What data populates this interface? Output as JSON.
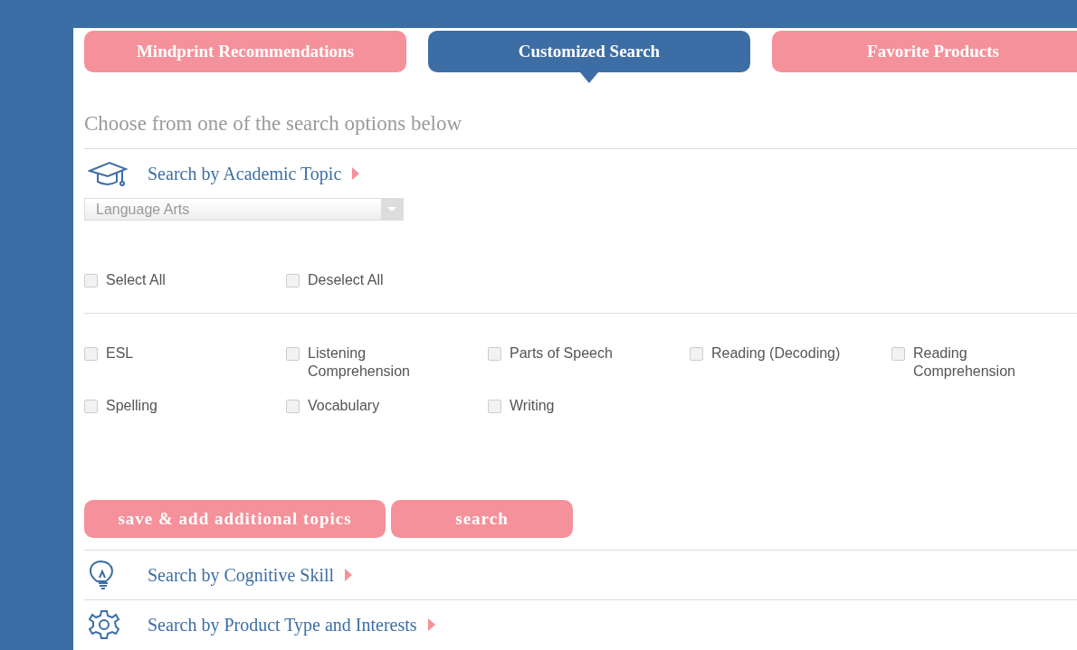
{
  "tabs": [
    {
      "label": "Mindprint Recommendations",
      "selected": false
    },
    {
      "label": "Customized Search",
      "selected": true
    },
    {
      "label": "Favorite Products",
      "selected": false
    }
  ],
  "heading": "Choose from one of the search options below",
  "academic": {
    "kind": "cap",
    "title": "Search by Academic Topic",
    "dropdown": {
      "value": "Language Arts"
    },
    "bulk": [
      {
        "label": "Select All",
        "checked": false
      },
      {
        "label": "Deselect All",
        "checked": false
      }
    ],
    "topics": [
      {
        "label": "ESL",
        "checked": false
      },
      {
        "label": "Listening Comprehension",
        "checked": false
      },
      {
        "label": "Parts of Speech",
        "checked": false
      },
      {
        "label": "Reading (Decoding)",
        "checked": false
      },
      {
        "label": "Reading Comprehension",
        "checked": false
      },
      {
        "label": "Spelling",
        "checked": false
      },
      {
        "label": "Vocabulary",
        "checked": false
      },
      {
        "label": "Writing",
        "checked": false
      }
    ],
    "buttons": [
      "save & add additional topics",
      "search"
    ]
  },
  "other_sections": [
    {
      "kind": "bulb",
      "title": "Search by Cognitive Skill"
    },
    {
      "kind": "gear",
      "title": "Search by Product Type and Interests"
    }
  ]
}
